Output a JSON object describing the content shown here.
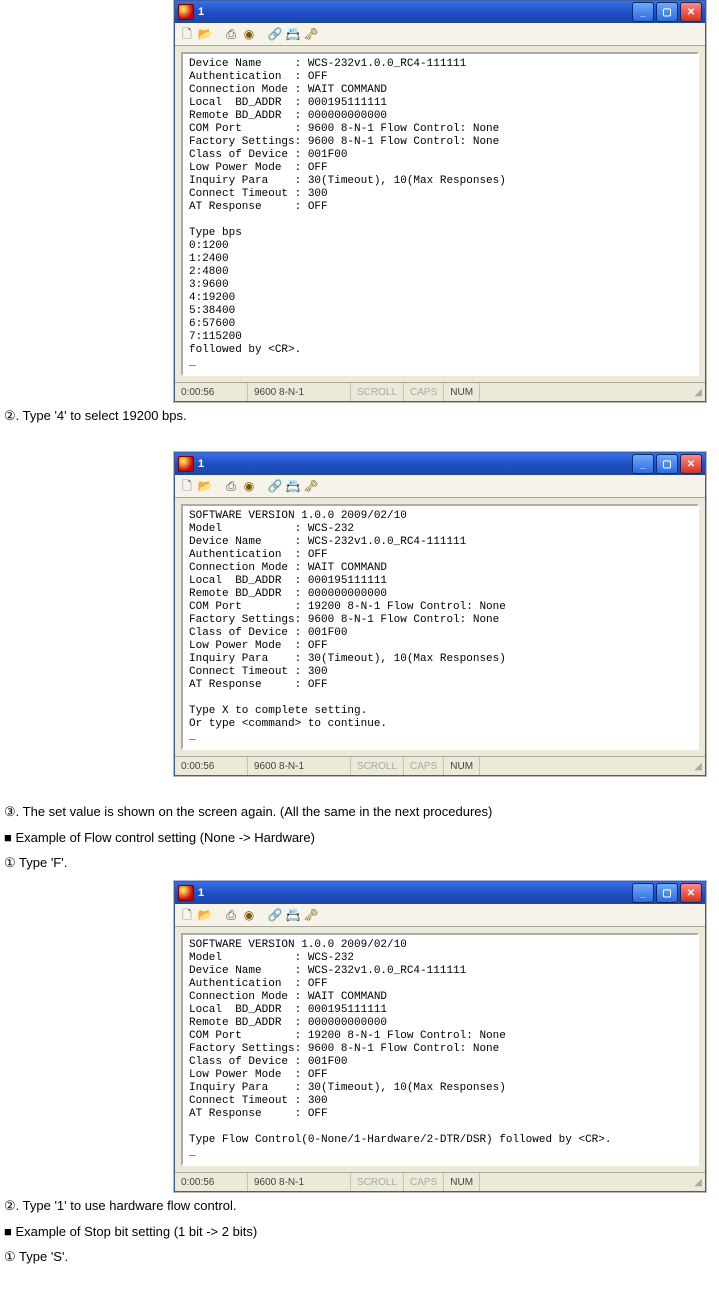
{
  "steps": {
    "s2": "②. Type '4' to select 19200 bps.",
    "s3": "③. The set value is shown on the screen again. (All the same in the next procedures)",
    "flow_heading": "■ Example of Flow control setting (None -> Hardware)",
    "flow_s1": "① Type 'F'.",
    "flow_s2": "②. Type '1' to use hardware flow control.",
    "stop_heading": "■ Example of Stop bit setting (1 bit -> 2 bits)",
    "stop_s1": "① Type 'S'."
  },
  "window": {
    "title": "1",
    "toolbar_icons": {
      "new": "🗋",
      "open": "📂",
      "print": "⎙",
      "rec": "◉",
      "link": "🔗",
      "props": "📇",
      "lock": "🗝"
    },
    "status": {
      "time": "0:00:56",
      "mode": "9600 8-N-1",
      "scroll": "SCROLL",
      "caps": "CAPS",
      "num": "NUM"
    }
  },
  "terminals": {
    "t1": "Device Name     : WCS-232v1.0.0_RC4-111111\nAuthentication  : OFF\nConnection Mode : WAIT COMMAND\nLocal  BD_ADDR  : 000195111111\nRemote BD_ADDR  : 000000000000\nCOM Port        : 9600 8-N-1 Flow Control: None\nFactory Settings: 9600 8-N-1 Flow Control: None\nClass of Device : 001F00\nLow Power Mode  : OFF\nInquiry Para    : 30(Timeout), 10(Max Responses)\nConnect Timeout : 300\nAT Response     : OFF\n\nType bps\n0:1200\n1:2400\n2:4800\n3:9600\n4:19200\n5:38400\n6:57600\n7:115200\nfollowed by <CR>.\n_",
    "t2": "SOFTWARE VERSION 1.0.0 2009/02/10\nModel           : WCS-232\nDevice Name     : WCS-232v1.0.0_RC4-111111\nAuthentication  : OFF\nConnection Mode : WAIT COMMAND\nLocal  BD_ADDR  : 000195111111\nRemote BD_ADDR  : 000000000000\nCOM Port        : 19200 8-N-1 Flow Control: None\nFactory Settings: 9600 8-N-1 Flow Control: None\nClass of Device : 001F00\nLow Power Mode  : OFF\nInquiry Para    : 30(Timeout), 10(Max Responses)\nConnect Timeout : 300\nAT Response     : OFF\n\nType X to complete setting.\nOr type <command> to continue.\n_",
    "t3": "SOFTWARE VERSION 1.0.0 2009/02/10\nModel           : WCS-232\nDevice Name     : WCS-232v1.0.0_RC4-111111\nAuthentication  : OFF\nConnection Mode : WAIT COMMAND\nLocal  BD_ADDR  : 000195111111\nRemote BD_ADDR  : 000000000000\nCOM Port        : 19200 8-N-1 Flow Control: None\nFactory Settings: 9600 8-N-1 Flow Control: None\nClass of Device : 001F00\nLow Power Mode  : OFF\nInquiry Para    : 30(Timeout), 10(Max Responses)\nConnect Timeout : 300\nAT Response     : OFF\n\nType Flow Control(0-None/1-Hardware/2-DTR/DSR) followed by <CR>.\n_"
  }
}
